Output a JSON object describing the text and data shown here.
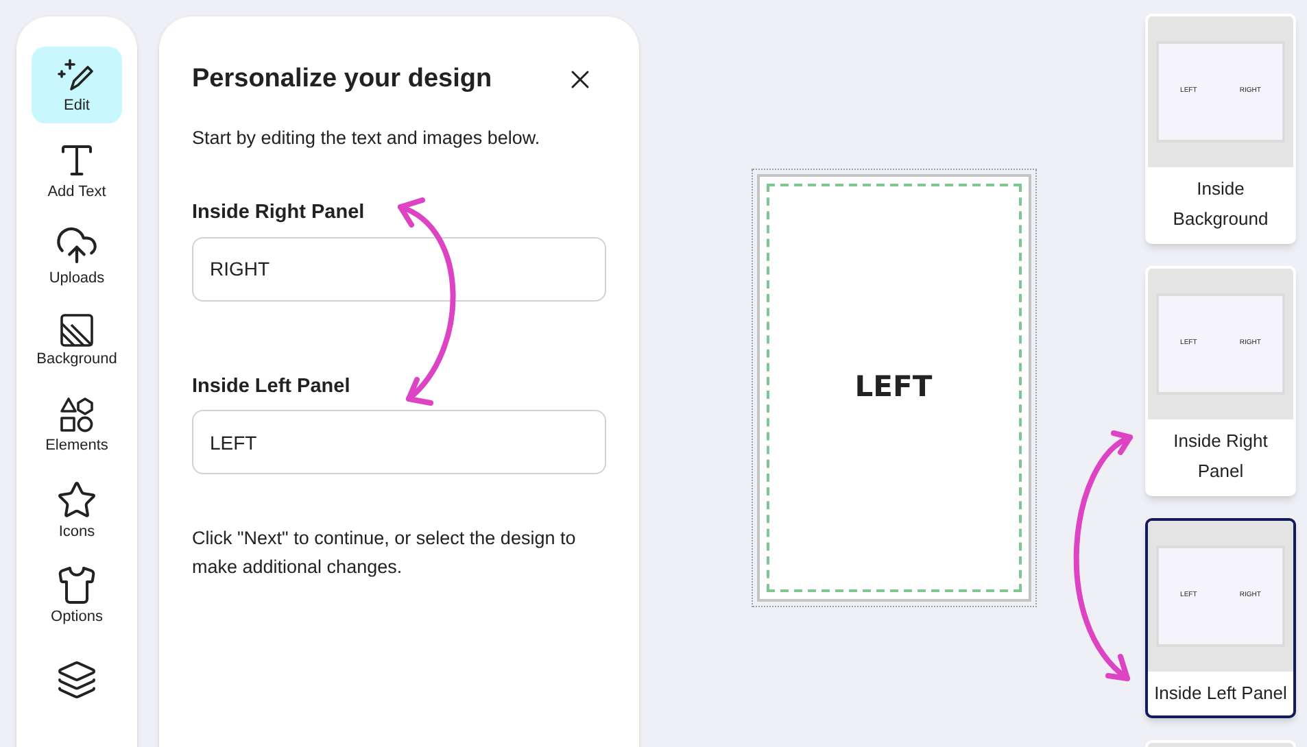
{
  "sidebar": {
    "items": [
      {
        "kind": "edit",
        "label": "Edit",
        "selected": true
      },
      {
        "kind": "text",
        "label": "Add Text",
        "selected": false
      },
      {
        "kind": "upload",
        "label": "Uploads",
        "selected": false
      },
      {
        "kind": "background",
        "label": "Background",
        "selected": false
      },
      {
        "kind": "elements",
        "label": "Elements",
        "selected": false
      },
      {
        "kind": "star",
        "label": "Icons",
        "selected": false
      },
      {
        "kind": "shirt",
        "label": "Options",
        "selected": false
      },
      {
        "kind": "layers",
        "selected": false
      }
    ]
  },
  "panel": {
    "title": "Personalize your design",
    "intro": "Start by editing the text and images below.",
    "fields": [
      {
        "label": "Inside Right Panel",
        "value": "RIGHT"
      },
      {
        "label": "Inside Left Panel",
        "value": "LEFT"
      }
    ],
    "footer": "Click \"Next\" to continue, or select the design to make additional changes."
  },
  "canvas": {
    "text": "LEFT"
  },
  "thumbnails": [
    {
      "label": "Inside Background",
      "left_text": "LEFT",
      "right_text": "RIGHT",
      "selected": false
    },
    {
      "label": "Inside Right Panel",
      "left_text": "LEFT",
      "right_text": "RIGHT",
      "selected": false
    },
    {
      "label": "Inside Left Panel",
      "left_text": "LEFT",
      "right_text": "RIGHT",
      "selected": true
    },
    {
      "selected": false
    }
  ]
}
